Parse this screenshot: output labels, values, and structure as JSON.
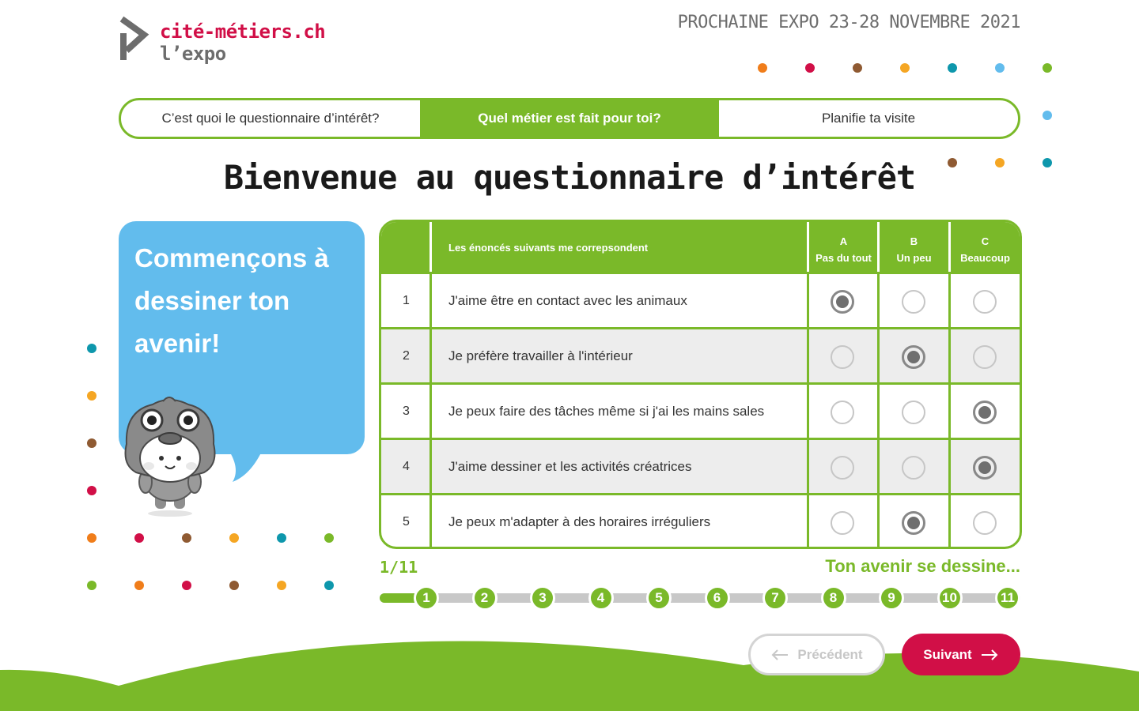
{
  "header": {
    "logo_name": "cité-métiers.ch",
    "logo_sub": "l’expo",
    "expo_date": "PROCHAINE EXPO 23-28 NOVEMBRE 2021"
  },
  "tabs": [
    {
      "label": "C’est quoi le questionnaire d’intérêt?",
      "active": false
    },
    {
      "label": "Quel métier est fait pour toi?",
      "active": true
    },
    {
      "label": "Planifie ta visite",
      "active": false
    }
  ],
  "page_title": "Bienvenue au questionnaire d’intérêt",
  "bubble_text": "Commençons à dessiner ton avenir!",
  "table": {
    "header_label": "Les énoncés suivants me correpsondent",
    "options": [
      {
        "letter": "A",
        "label": "Pas du tout"
      },
      {
        "letter": "B",
        "label": "Un peu"
      },
      {
        "letter": "C",
        "label": "Beaucoup"
      }
    ],
    "rows": [
      {
        "num": "1",
        "text": "J'aime être en contact avec les animaux",
        "selected": "A"
      },
      {
        "num": "2",
        "text": "Je préfère travailler à l'intérieur",
        "selected": "B"
      },
      {
        "num": "3",
        "text": "Je peux faire des tâches même si j'ai les mains sales",
        "selected": "C"
      },
      {
        "num": "4",
        "text": "J'aime dessiner et les activités créatrices",
        "selected": "C"
      },
      {
        "num": "5",
        "text": "Je peux m'adapter à des horaires irréguliers",
        "selected": "B"
      }
    ]
  },
  "progress": {
    "counter": "1/11",
    "motto": "Ton avenir se dessine...",
    "current": 1,
    "steps": [
      "1",
      "2",
      "3",
      "4",
      "5",
      "6",
      "7",
      "8",
      "9",
      "10",
      "11"
    ]
  },
  "buttons": {
    "prev_label": "Précédent",
    "next_label": "Suivant"
  },
  "colors": {
    "green": "#7ab929",
    "red": "#d10f47",
    "blue": "#62bced",
    "grey": "#6d6d6d"
  }
}
